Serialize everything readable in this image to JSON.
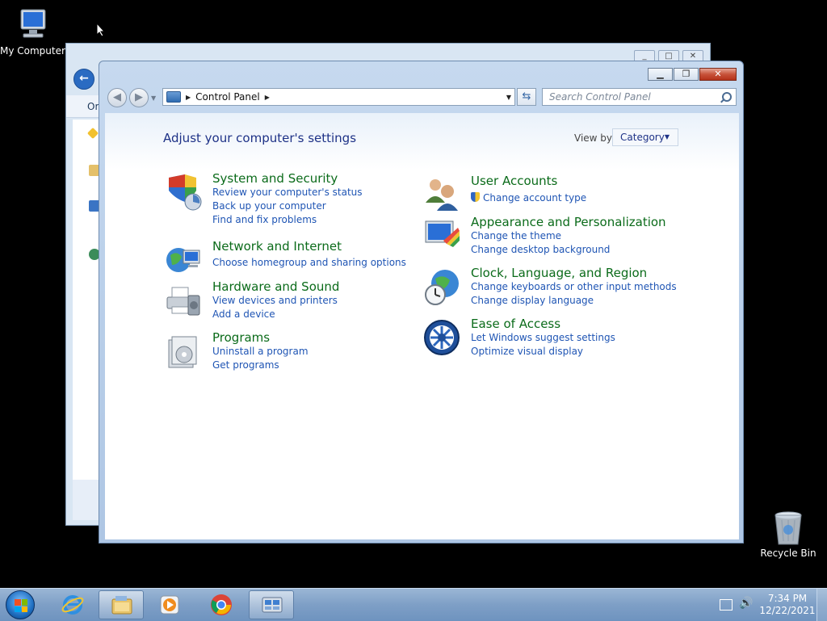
{
  "desktop": {
    "icons": [
      {
        "label": "My Computer"
      },
      {
        "label": "Recycle Bin"
      }
    ]
  },
  "background_window": {
    "toolbar_label": "Or"
  },
  "window": {
    "address": {
      "breadcrumb": "Control Panel"
    },
    "search": {
      "placeholder": "Search Control Panel"
    }
  },
  "control_panel": {
    "heading": "Adjust your computer's settings",
    "view_by_label": "View by:",
    "view_by_value": "Category",
    "left_categories": [
      {
        "title": "System and Security",
        "links": [
          "Review your computer's status",
          "Back up your computer",
          "Find and fix problems"
        ]
      },
      {
        "title": "Network and Internet",
        "links": [
          "Choose homegroup and sharing options"
        ]
      },
      {
        "title": "Hardware and Sound",
        "links": [
          "View devices and printers",
          "Add a device"
        ]
      },
      {
        "title": "Programs",
        "links": [
          "Uninstall a program",
          "Get programs"
        ]
      }
    ],
    "right_categories": [
      {
        "title": "User Accounts",
        "links": [
          "Change account type"
        ]
      },
      {
        "title": "Appearance and Personalization",
        "links": [
          "Change the theme",
          "Change desktop background"
        ]
      },
      {
        "title": "Clock, Language, and Region",
        "links": [
          "Change keyboards or other input methods",
          "Change display language"
        ]
      },
      {
        "title": "Ease of Access",
        "links": [
          "Let Windows suggest settings",
          "Optimize visual display"
        ]
      }
    ]
  },
  "taskbar": {
    "pinned": [
      {
        "icon": "internet-explorer-icon"
      },
      {
        "icon": "windows-explorer-icon"
      },
      {
        "icon": "media-player-icon"
      },
      {
        "icon": "chrome-icon"
      },
      {
        "icon": "control-panel-icon"
      }
    ],
    "clock": {
      "time": "7:34 PM",
      "date": "12/22/2021"
    }
  }
}
